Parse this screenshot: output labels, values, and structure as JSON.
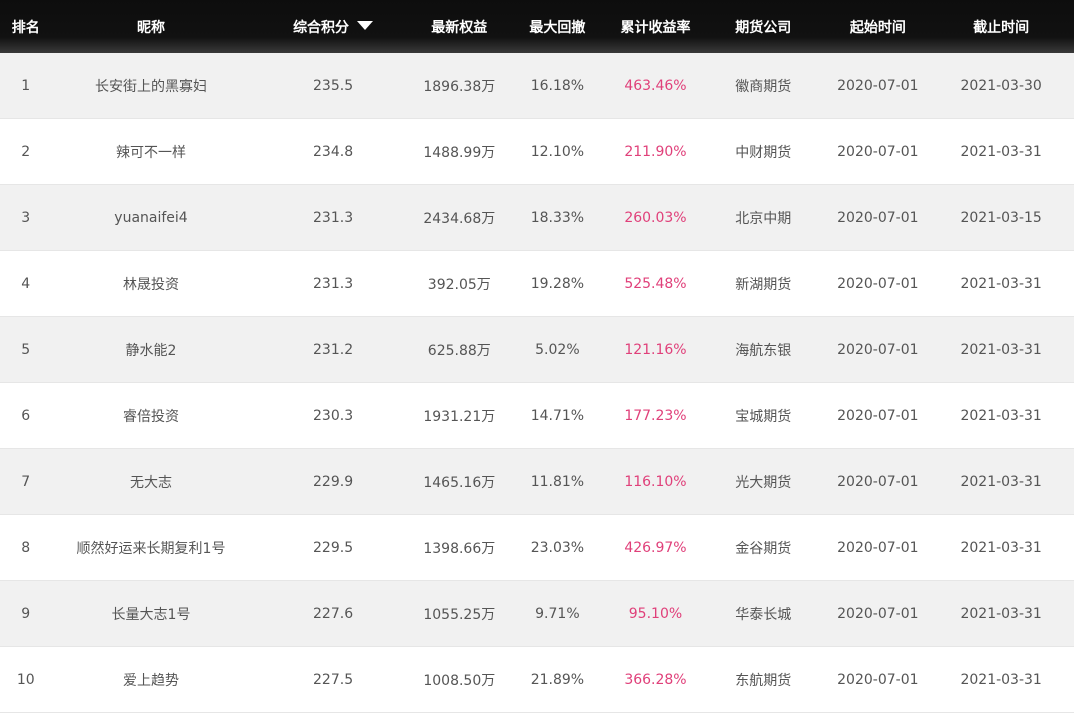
{
  "columns": {
    "rank": "排名",
    "nickname": "昵称",
    "score": "综合积分",
    "equity": "最新权益",
    "drawdown": "最大回撤",
    "return": "累计收益率",
    "company": "期货公司",
    "start": "起始时间",
    "end": "截止时间"
  },
  "sort_icon": "triangle-down-icon",
  "accent_color": "#e0407a",
  "rows": [
    {
      "rank": "1",
      "nickname": "长安街上的黑寡妇",
      "score": "235.5",
      "equity": "1896.38万",
      "drawdown": "16.18%",
      "return": "463.46%",
      "company": "徽商期货",
      "start": "2020-07-01",
      "end": "2021-03-30"
    },
    {
      "rank": "2",
      "nickname": "辣可不一样",
      "score": "234.8",
      "equity": "1488.99万",
      "drawdown": "12.10%",
      "return": "211.90%",
      "company": "中财期货",
      "start": "2020-07-01",
      "end": "2021-03-31"
    },
    {
      "rank": "3",
      "nickname": "yuanaifei4",
      "score": "231.3",
      "equity": "2434.68万",
      "drawdown": "18.33%",
      "return": "260.03%",
      "company": "北京中期",
      "start": "2020-07-01",
      "end": "2021-03-15"
    },
    {
      "rank": "4",
      "nickname": "林晟投资",
      "score": "231.3",
      "equity": "392.05万",
      "drawdown": "19.28%",
      "return": "525.48%",
      "company": "新湖期货",
      "start": "2020-07-01",
      "end": "2021-03-31"
    },
    {
      "rank": "5",
      "nickname": "静水能2",
      "score": "231.2",
      "equity": "625.88万",
      "drawdown": "5.02%",
      "return": "121.16%",
      "company": "海航东银",
      "start": "2020-07-01",
      "end": "2021-03-31"
    },
    {
      "rank": "6",
      "nickname": "睿倍投资",
      "score": "230.3",
      "equity": "1931.21万",
      "drawdown": "14.71%",
      "return": "177.23%",
      "company": "宝城期货",
      "start": "2020-07-01",
      "end": "2021-03-31"
    },
    {
      "rank": "7",
      "nickname": "无大志",
      "score": "229.9",
      "equity": "1465.16万",
      "drawdown": "11.81%",
      "return": "116.10%",
      "company": "光大期货",
      "start": "2020-07-01",
      "end": "2021-03-31"
    },
    {
      "rank": "8",
      "nickname": "顺然好运来长期复利1号",
      "score": "229.5",
      "equity": "1398.66万",
      "drawdown": "23.03%",
      "return": "426.97%",
      "company": "金谷期货",
      "start": "2020-07-01",
      "end": "2021-03-31"
    },
    {
      "rank": "9",
      "nickname": "长量大志1号",
      "score": "227.6",
      "equity": "1055.25万",
      "drawdown": "9.71%",
      "return": "95.10%",
      "company": "华泰长城",
      "start": "2020-07-01",
      "end": "2021-03-31"
    },
    {
      "rank": "10",
      "nickname": "爱上趋势",
      "score": "227.5",
      "equity": "1008.50万",
      "drawdown": "21.89%",
      "return": "366.28%",
      "company": "东航期货",
      "start": "2020-07-01",
      "end": "2021-03-31"
    }
  ]
}
